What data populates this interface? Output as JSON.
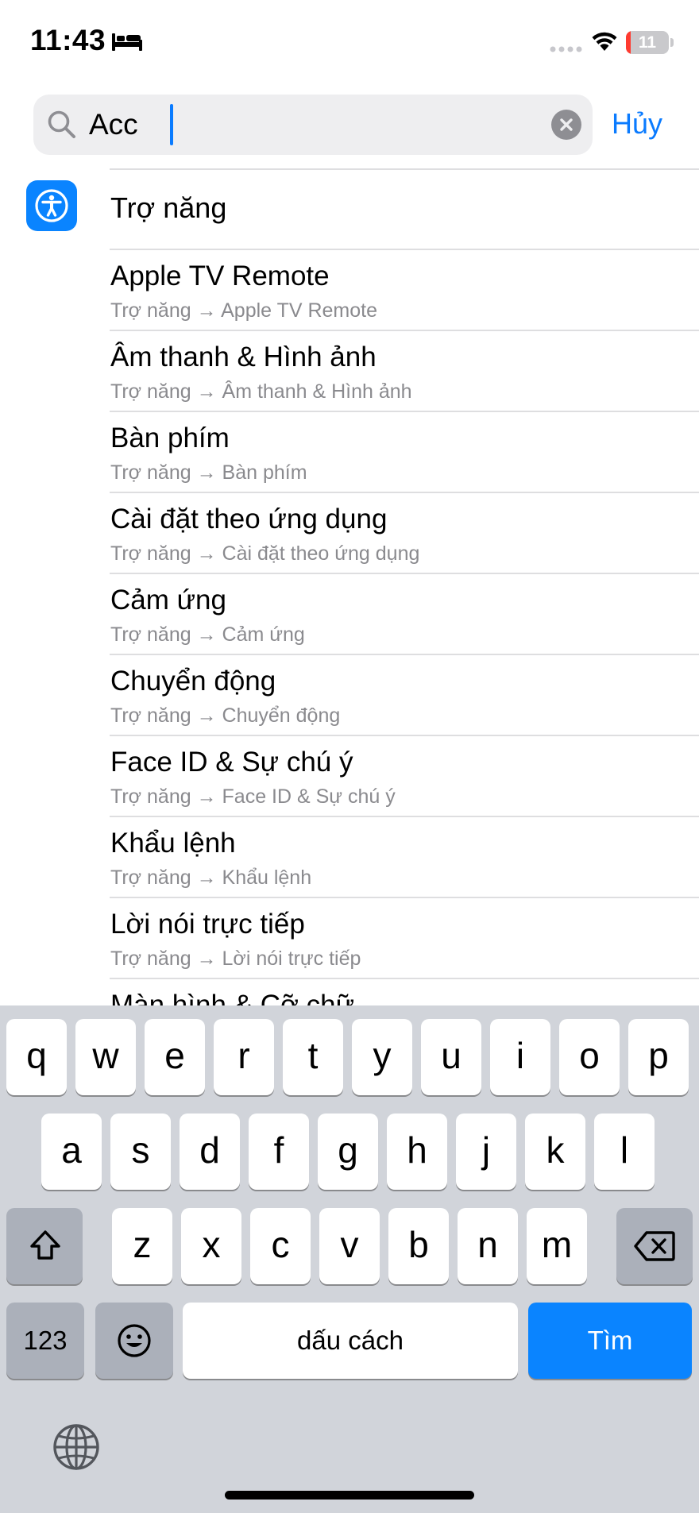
{
  "status_bar": {
    "time": "11:43",
    "battery": "11",
    "battery_level_percent": 11,
    "icons": [
      "bed-icon",
      "signal-dots-icon",
      "wifi-icon",
      "battery-icon"
    ]
  },
  "search": {
    "value": "Acc",
    "cancel_label": "Hủy",
    "icons": [
      "search-icon",
      "clear-icon"
    ]
  },
  "results": {
    "header": {
      "label": "Trợ năng",
      "icon": "accessibility-icon",
      "icon_color": "#0a84ff"
    },
    "items": [
      {
        "title": "Apple TV Remote",
        "path": "Trợ năng → Apple TV Remote"
      },
      {
        "title": "Âm thanh & Hình ảnh",
        "path": "Trợ năng → Âm thanh & Hình ảnh"
      },
      {
        "title": "Bàn phím",
        "path": "Trợ năng → Bàn phím"
      },
      {
        "title": "Cài đặt theo ứng dụng",
        "path": "Trợ năng → Cài đặt theo ứng dụng"
      },
      {
        "title": "Cảm ứng",
        "path": "Trợ năng → Cảm ứng"
      },
      {
        "title": "Chuyển động",
        "path": "Trợ năng → Chuyển động"
      },
      {
        "title": "Face ID & Sự chú ý",
        "path": "Trợ năng → Face ID & Sự chú ý"
      },
      {
        "title": "Khẩu lệnh",
        "path": "Trợ năng → Khẩu lệnh"
      },
      {
        "title": "Lời nói trực tiếp",
        "path": "Trợ năng → Lời nói trực tiếp"
      },
      {
        "title": "Màn hình & Cỡ chữ",
        "path": ""
      }
    ]
  },
  "keyboard": {
    "row1": [
      "q",
      "w",
      "e",
      "r",
      "t",
      "y",
      "u",
      "i",
      "o",
      "p"
    ],
    "row2": [
      "a",
      "s",
      "d",
      "f",
      "g",
      "h",
      "j",
      "k",
      "l"
    ],
    "row3": [
      "z",
      "x",
      "c",
      "v",
      "b",
      "n",
      "m"
    ],
    "numbers_label": "123",
    "space_label": "dấu cách",
    "return_label": "Tìm",
    "return_color": "#0a84ff",
    "icons": [
      "shift-icon",
      "delete-icon",
      "emoji-icon",
      "globe-icon"
    ]
  }
}
